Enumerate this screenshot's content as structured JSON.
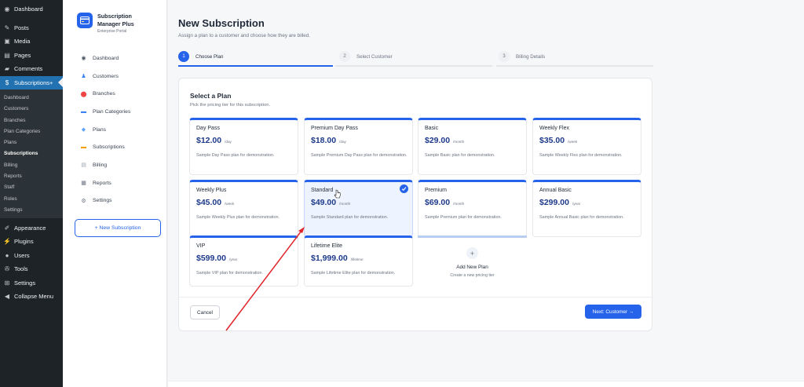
{
  "wp_menu": {
    "top": [
      {
        "label": "Dashboard",
        "icon": "dashboard-icon"
      }
    ],
    "group1": [
      {
        "label": "Posts",
        "icon": "pin-icon"
      },
      {
        "label": "Media",
        "icon": "media-icon"
      },
      {
        "label": "Pages",
        "icon": "pages-icon"
      },
      {
        "label": "Comments",
        "icon": "comment-icon"
      }
    ],
    "active": {
      "label": "Subscriptions+",
      "icon": "dollar-icon"
    },
    "submenu": [
      "Dashboard",
      "Customers",
      "Branches",
      "Plan Categories",
      "Plans",
      "Subscriptions",
      "Billing",
      "Reports",
      "Staff",
      "Roles",
      "Settings"
    ],
    "submenu_current": "Subscriptions",
    "group2": [
      {
        "label": "Appearance",
        "icon": "brush-icon"
      },
      {
        "label": "Plugins",
        "icon": "plug-icon"
      },
      {
        "label": "Users",
        "icon": "user-icon"
      },
      {
        "label": "Tools",
        "icon": "wrench-icon"
      },
      {
        "label": "Settings",
        "icon": "settings-icon"
      },
      {
        "label": "Collapse Menu",
        "icon": "collapse-icon"
      }
    ]
  },
  "plugin": {
    "name_line1": "Subscription",
    "name_line2": "Manager Plus",
    "subtitle": "Enterprise Portal",
    "nav": [
      {
        "label": "Dashboard",
        "icon": "dashboard-icon"
      },
      {
        "label": "Customers",
        "icon": "customers-icon"
      },
      {
        "label": "Branches",
        "icon": "location-pin-icon"
      },
      {
        "label": "Plan Categories",
        "icon": "folder-icon"
      },
      {
        "label": "Plans",
        "icon": "tag-icon"
      },
      {
        "label": "Subscriptions",
        "icon": "card-icon"
      },
      {
        "label": "Billing",
        "icon": "receipt-icon"
      },
      {
        "label": "Reports",
        "icon": "chart-icon"
      },
      {
        "label": "Settings",
        "icon": "gear-icon"
      }
    ],
    "new_button": "+ New Subscription"
  },
  "page": {
    "title": "New Subscription",
    "subtitle": "Assign a plan to a customer and choose how they are billed."
  },
  "steps": [
    {
      "num": "1",
      "label": "Choose Plan",
      "active": true
    },
    {
      "num": "2",
      "label": "Select Customer",
      "active": false
    },
    {
      "num": "3",
      "label": "Billing Details",
      "active": false
    }
  ],
  "plan_section": {
    "title": "Select a Plan",
    "subtitle": "Pick the pricing tier for this subscription."
  },
  "plans": [
    {
      "name": "Day Pass",
      "price": "$12.00",
      "period": "/day",
      "desc": "Sample Day Pass plan for demonstration."
    },
    {
      "name": "Premium Day Pass",
      "price": "$18.00",
      "period": "/day",
      "desc": "Sample Premium Day Pass plan for demonstration."
    },
    {
      "name": "Basic",
      "price": "$29.00",
      "period": "/month",
      "desc": "Sample Basic plan for demonstration."
    },
    {
      "name": "Weekly Flex",
      "price": "$35.00",
      "period": "/week",
      "desc": "Sample Weekly Flex plan for demonstration."
    },
    {
      "name": "Weekly Plus",
      "price": "$45.00",
      "period": "/week",
      "desc": "Sample Weekly Plus plan for demonstration."
    },
    {
      "name": "Standard",
      "price": "$49.00",
      "period": "/month",
      "desc": "Sample Standard plan for demonstration.",
      "selected": true
    },
    {
      "name": "Premium",
      "price": "$69.00",
      "period": "/month",
      "desc": "Sample Premium plan for demonstration."
    },
    {
      "name": "Annual Basic",
      "price": "$299.00",
      "period": "/year",
      "desc": "Sample Annual Basic plan for demonstration."
    },
    {
      "name": "VIP",
      "price": "$599.00",
      "period": "/year",
      "desc": "Sample VIP plan for demonstration."
    },
    {
      "name": "Lifetime Elite",
      "price": "$1,999.00",
      "period": "/lifetime",
      "desc": "Sample Lifetime Elite plan for demonstration."
    }
  ],
  "add_plan": {
    "icon_text": "+",
    "title": "Add New Plan",
    "subtitle": "Create a new pricing tier"
  },
  "actions": {
    "cancel": "Cancel",
    "next": "Next: Customer →"
  },
  "colors": {
    "wp_sidebar": "#1d2327",
    "wp_active": "#2271b1",
    "accent": "#2563eb",
    "price": "#1e3a8a",
    "annotation_arrow": "#e0242a"
  }
}
